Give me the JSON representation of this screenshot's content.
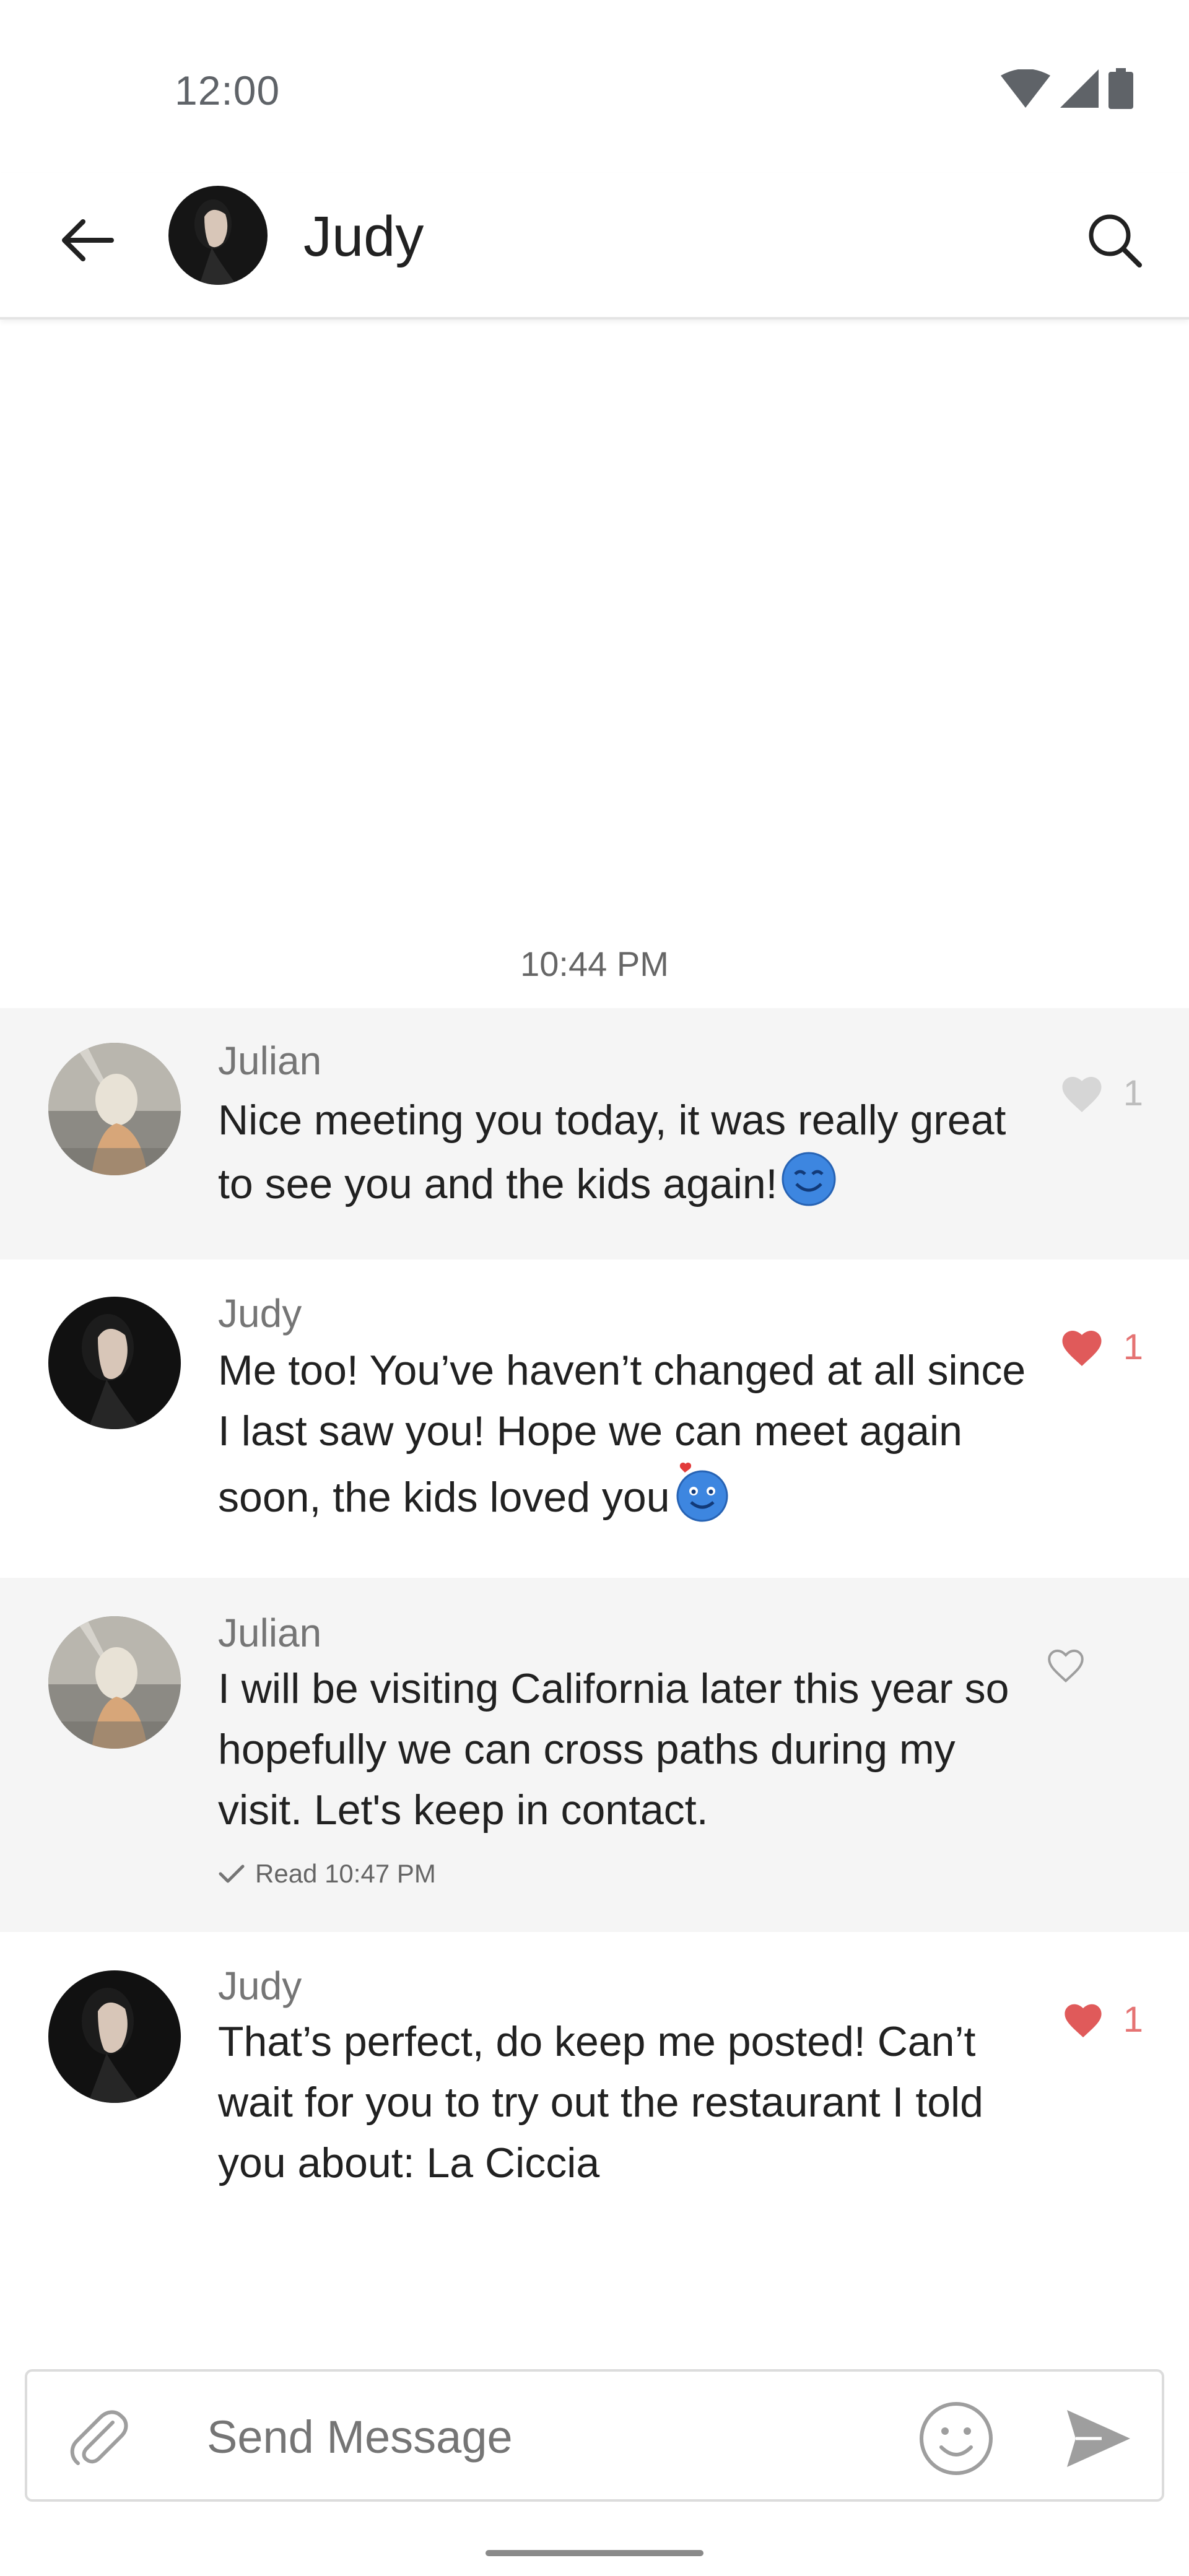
{
  "status_bar": {
    "time": "12:00"
  },
  "header": {
    "contact_name": "Judy"
  },
  "conversation": {
    "timestamp": "10:44 PM",
    "messages": [
      {
        "sender": "Julian",
        "text": "Nice meeting you today, it was really great to see you and the kids again!",
        "emoji": "smiling-face-emoji",
        "liked": false,
        "like_count": "1"
      },
      {
        "sender": "Judy",
        "text": "Me too! You’ve haven’t changed at all since I last saw you! Hope we can meet again soon, the kids loved you",
        "emoji": "face-with-heart-emoji",
        "liked": true,
        "like_count": "1"
      },
      {
        "sender": "Julian",
        "text": "I will be visiting California later this year so hopefully we can cross paths during my visit. Let's keep in contact.",
        "liked": false,
        "like_count": "",
        "read_receipt": "Read 10:47 PM"
      },
      {
        "sender": "Judy",
        "text": "That’s perfect, do keep me posted! Can’t wait for you to try out the restaurant I told you about: La Ciccia",
        "liked": true,
        "like_count": "1"
      }
    ]
  },
  "composer": {
    "placeholder": "Send Message",
    "value": ""
  },
  "colors": {
    "like_red": "#e57373",
    "bubble_gray": "#f5f5f5",
    "emoji_blue": "#3d86e0"
  }
}
